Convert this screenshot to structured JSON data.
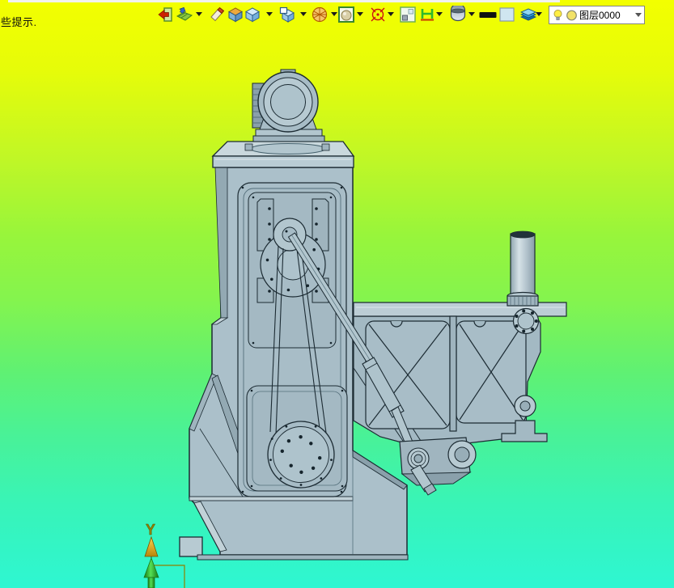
{
  "window": {
    "hint_text": "些提示.",
    "top_strip_color": "#f2f2ee"
  },
  "toolbar": {
    "background_color": "#f3ff00",
    "items": [
      {
        "name": "exit-icon",
        "has_dropdown": false
      },
      {
        "name": "surface-icon",
        "has_dropdown": true
      },
      {
        "name": "eraser-icon",
        "has_dropdown": false
      },
      {
        "name": "solid-box-icon",
        "has_dropdown": false
      },
      {
        "name": "cube-icon",
        "has_dropdown": true
      },
      {
        "name": "cube-window-icon",
        "has_dropdown": true
      },
      {
        "name": "wire-sphere-icon",
        "has_dropdown": true
      },
      {
        "name": "sphere-frame-icon",
        "has_dropdown": true
      },
      {
        "name": "target-icon",
        "has_dropdown": true
      },
      {
        "name": "corner-box-icon",
        "has_dropdown": false
      },
      {
        "name": "clamp-icon",
        "has_dropdown": true
      },
      {
        "name": "shaded-sphere-icon",
        "has_dropdown": true
      },
      {
        "name": "black-bar-icon",
        "has_dropdown": false
      },
      {
        "name": "color-swatch-icon",
        "has_dropdown": false
      },
      {
        "name": "layers-icon",
        "has_dropdown": true
      }
    ],
    "layer_combo": {
      "value": "图层0000",
      "icons": [
        "bulb-icon",
        "circle-icon"
      ]
    }
  },
  "viewport": {
    "background_gradient": [
      "#f3ff00",
      "#98f53b",
      "#2ef6d2"
    ],
    "model": {
      "description": "gray 3D machine model (column with motor, crank, belt drive, flywheel and truss work-table)",
      "body_color": "#abc0ca",
      "outline_color": "#1c2b33"
    },
    "axis_indicator": {
      "label": "Y",
      "label_color": "#8f8000",
      "cone_color": "#e8a317",
      "arrow_color": "#2ecc2e"
    }
  }
}
